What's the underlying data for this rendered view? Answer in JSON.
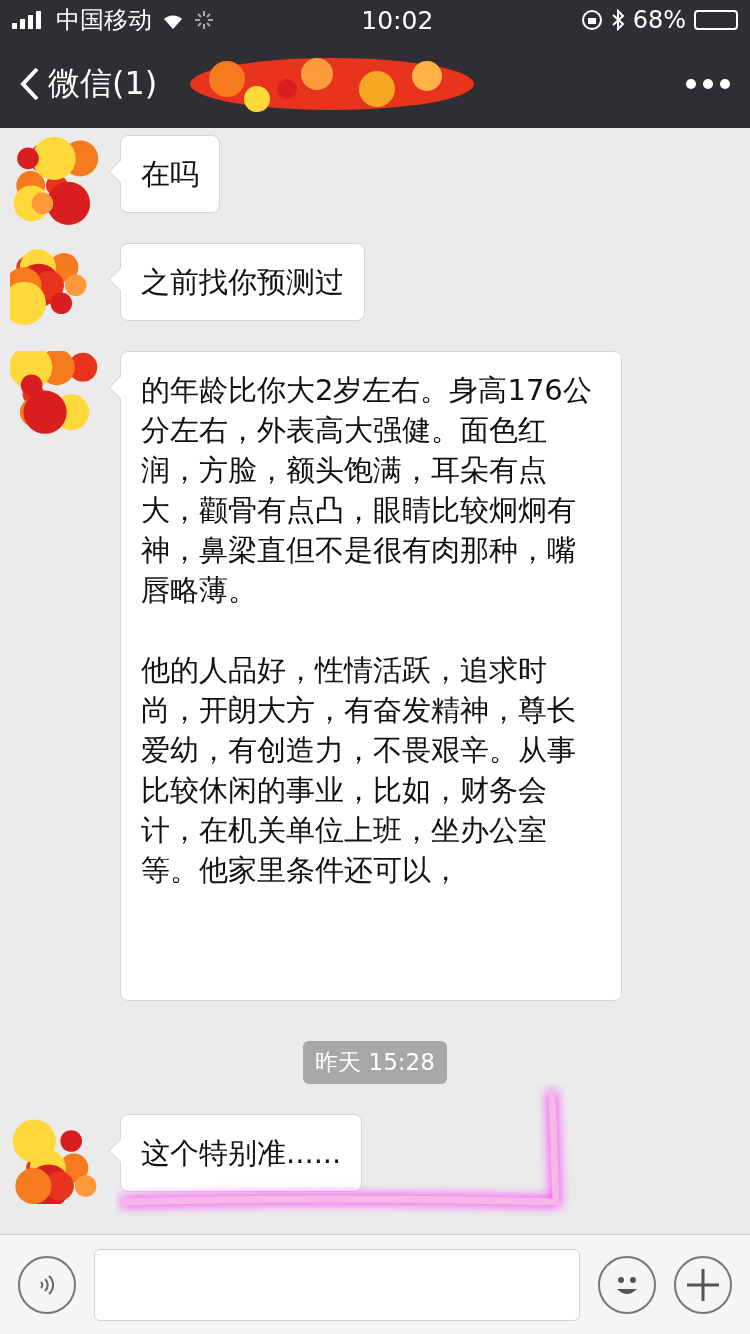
{
  "status_bar": {
    "carrier": "中国移动",
    "time": "10:02",
    "battery": "68%"
  },
  "nav": {
    "back_label": "微信(1)"
  },
  "messages": [
    {
      "kind": "text",
      "paragraphs": [
        "在吗"
      ],
      "highlighted": false
    },
    {
      "kind": "text",
      "paragraphs": [
        "之前找你预测过"
      ],
      "highlighted": false
    },
    {
      "kind": "text",
      "paragraphs": [
        "的年龄比你大2岁左右。身高176公分左右，外表高大强健。面色红润，方脸，额头饱满，耳朵有点大，颧骨有点凸，眼睛比较炯炯有神，鼻梁直但不是很有肉那种，嘴唇略薄。",
        "他的人品好，性情活跃，追求时尚，开朗大方，有奋发精神，尊长爱幼，有创造力，不畏艰辛。从事比较休闲的事业，比如，财务会计，在机关单位上班，坐办公室等。他家里条件还可以，"
      ],
      "highlighted": false
    },
    {
      "kind": "timestamp",
      "text": "昨天 15:28"
    },
    {
      "kind": "text",
      "paragraphs": [
        "这个特别准......"
      ],
      "highlighted": true
    }
  ]
}
